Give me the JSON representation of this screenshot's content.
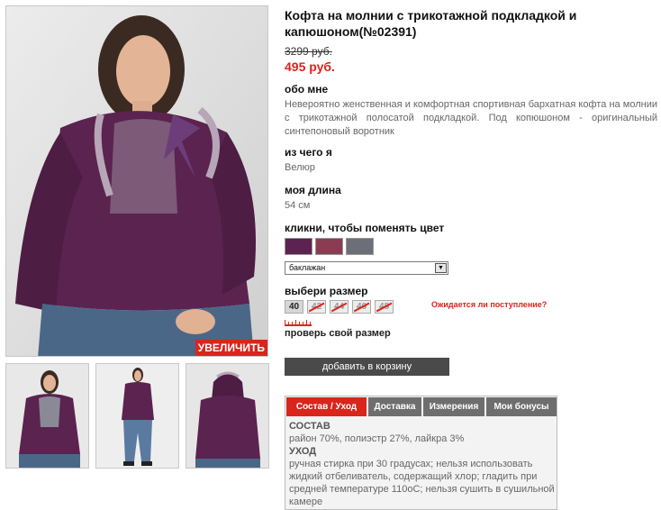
{
  "product": {
    "title": "Кофта на молнии с трикотажной подкладкой и капюшоном(№02391)",
    "old_price": "3299 руб.",
    "new_price": "495 руб."
  },
  "gallery": {
    "zoom_label": "УВЕЛИЧИТЬ"
  },
  "about": {
    "heading": "обо мне",
    "text": "Невероятно женственная и комфортная спортивная бархатная кофта на молнии с трикотажной полосатой подкладкой. Под копюшоном - оригинальный синтепоновый воротник"
  },
  "material": {
    "heading": "из чего я",
    "text": "Велюр"
  },
  "length": {
    "heading": "моя длина",
    "text": "54 см"
  },
  "color": {
    "heading": "кликни, чтобы поменять цвет",
    "selected": "баклажан",
    "swatches": [
      "#5c2350",
      "#8a3d52",
      "#6d6f78"
    ]
  },
  "size": {
    "heading": "выбери размер",
    "options": [
      "40",
      "42",
      "44",
      "46",
      "48"
    ],
    "available": [
      "40"
    ],
    "waiting_link": "Ожидается ли поступление?",
    "check_label": "проверь свой размер"
  },
  "cart": {
    "button_label": "добавить в корзину"
  },
  "tabs": {
    "items": [
      "Состав / Уход",
      "Доставка",
      "Измерения",
      "Мои бонусы"
    ],
    "active": "Состав / Уход",
    "composition_heading": "СОСТАВ",
    "composition_text": "район 70%, полиэстр 27%, лайкра 3%",
    "care_heading": "УХОД",
    "care_text": "ручная стирка при 30 градусах; нельзя использовать жидкий отбеливатель, содержащий хлор; гладить при средней температуре 110оС; нельзя сушить в сушильной камере"
  },
  "colors": {
    "accent": "#d9251c",
    "button_dark": "#4a4a4a",
    "tab_gray": "#6e6e6e"
  }
}
